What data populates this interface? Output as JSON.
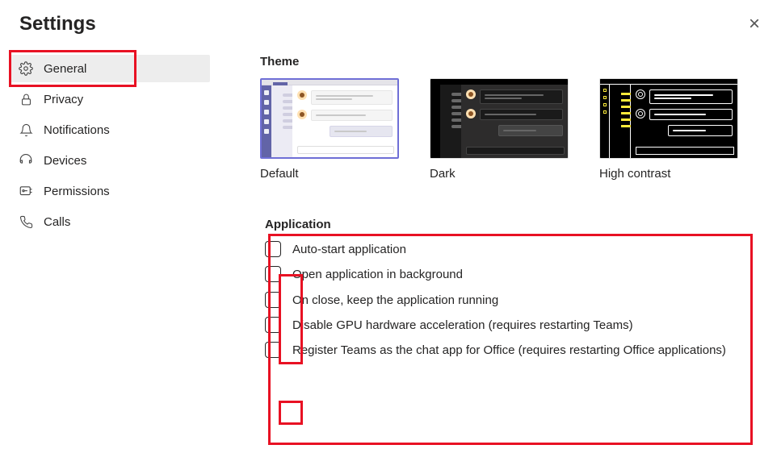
{
  "title": "Settings",
  "sidebar": {
    "items": [
      {
        "label": "General",
        "icon": "gear",
        "active": true
      },
      {
        "label": "Privacy",
        "icon": "lock",
        "active": false
      },
      {
        "label": "Notifications",
        "icon": "bell",
        "active": false
      },
      {
        "label": "Devices",
        "icon": "headset",
        "active": false
      },
      {
        "label": "Permissions",
        "icon": "key",
        "active": false
      },
      {
        "label": "Calls",
        "icon": "phone",
        "active": false
      }
    ]
  },
  "theme": {
    "heading": "Theme",
    "options": [
      {
        "label": "Default",
        "selected": true
      },
      {
        "label": "Dark",
        "selected": false
      },
      {
        "label": "High contrast",
        "selected": false
      }
    ]
  },
  "application": {
    "heading": "Application",
    "options": [
      {
        "label": "Auto-start application",
        "checked": false
      },
      {
        "label": "Open application in background",
        "checked": false
      },
      {
        "label": "On close, keep the application running",
        "checked": false
      },
      {
        "label": "Disable GPU hardware acceleration (requires restarting Teams)",
        "checked": false
      },
      {
        "label": "Register Teams as the chat app for Office (requires restarting Office applications)",
        "checked": false
      }
    ]
  },
  "annotations": {
    "highlight_color": "#e81123",
    "boxes": [
      "sidebar-general",
      "application-section",
      "checkboxes-first-three",
      "checkbox-register"
    ]
  }
}
